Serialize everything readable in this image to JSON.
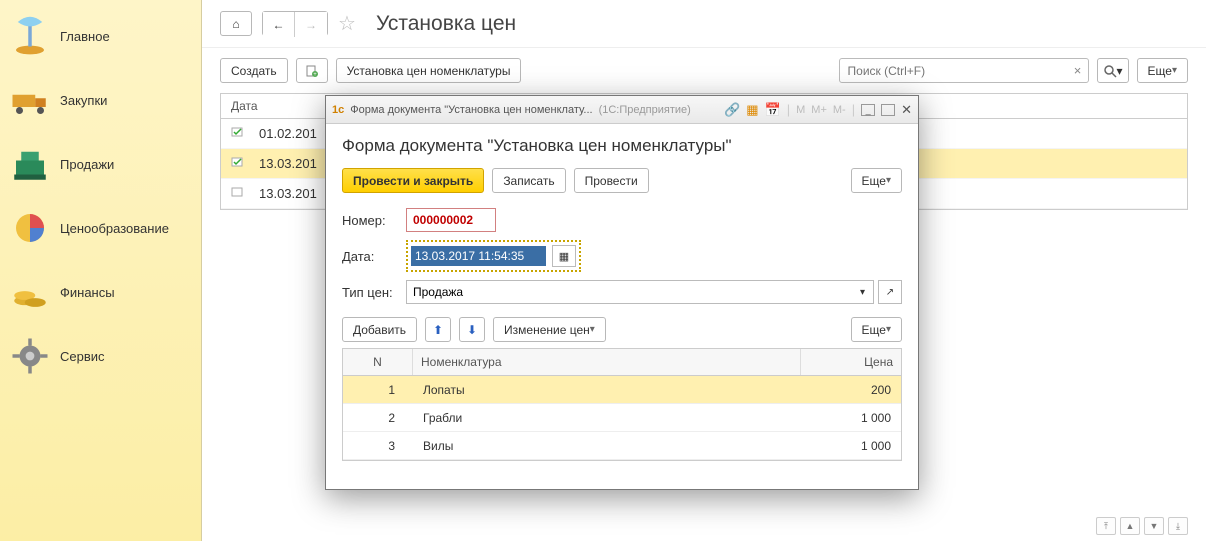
{
  "sidebar": {
    "items": [
      {
        "label": "Главное"
      },
      {
        "label": "Закупки"
      },
      {
        "label": "Продажи"
      },
      {
        "label": "Ценообразование"
      },
      {
        "label": "Финансы"
      },
      {
        "label": "Сервис"
      }
    ]
  },
  "header": {
    "title": "Установка цен"
  },
  "toolbar": {
    "create": "Создать",
    "set_prices": "Установка цен номенклатуры",
    "search_placeholder": "Поиск (Ctrl+F)",
    "more": "Еще"
  },
  "list": {
    "column": "Дата",
    "rows": [
      {
        "date": "01.02.201",
        "selected": false,
        "posted": true
      },
      {
        "date": "13.03.201",
        "selected": true,
        "posted": true
      },
      {
        "date": "13.03.201",
        "selected": false,
        "posted": false
      }
    ]
  },
  "modal": {
    "win_title": "Форма документа \"Установка цен номенклату...",
    "win_sub": "(1С:Предприятие)",
    "heading": "Форма документа \"Установка цен номенклатуры\"",
    "buttons": {
      "post_close": "Провести и закрыть",
      "save": "Записать",
      "post": "Провести",
      "more": "Еще"
    },
    "fields": {
      "number_label": "Номер:",
      "number": "000000002",
      "date_label": "Дата:",
      "date": "13.03.2017 11:54:35",
      "type_label": "Тип цен:",
      "type": "Продажа"
    },
    "grid_toolbar": {
      "add": "Добавить",
      "change": "Изменение цен",
      "more": "Еще"
    },
    "grid": {
      "col_n": "N",
      "col_name": "Номенклатура",
      "col_price": "Цена",
      "rows": [
        {
          "n": "1",
          "name": "Лопаты",
          "price": "200",
          "selected": true
        },
        {
          "n": "2",
          "name": "Грабли",
          "price": "1 000",
          "selected": false
        },
        {
          "n": "3",
          "name": "Вилы",
          "price": "1 000",
          "selected": false
        }
      ]
    }
  }
}
